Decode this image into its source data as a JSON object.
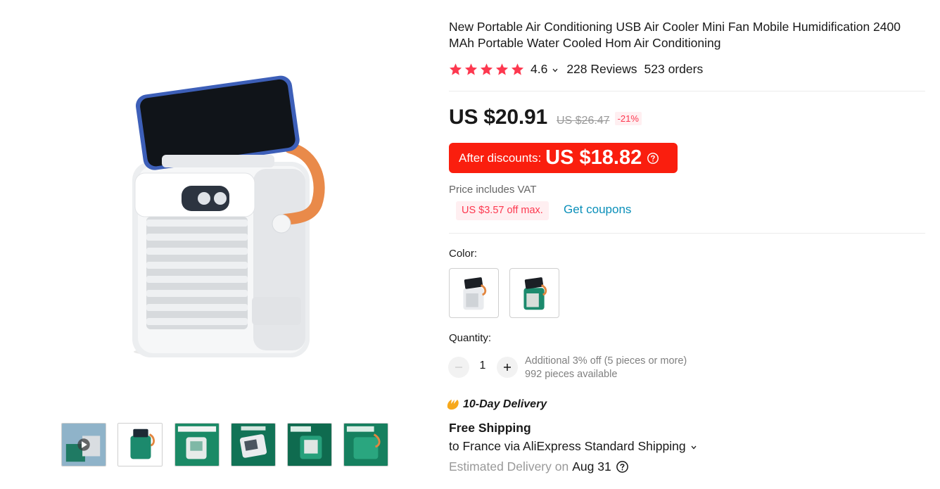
{
  "product": {
    "title": "New Portable Air Conditioning USB Air Cooler Mini Fan Mobile Humidification 2400 MAh Portable Water Cooled Hom Air Conditioning",
    "rating": "4.6",
    "reviews": "228 Reviews",
    "orders": "523 orders",
    "stars": 5
  },
  "gallery": {
    "main_image": "portable-air-cooler-with-phone-stand-image",
    "thumbnails": [
      {
        "name": "video-thumbnail",
        "icon": "play-icon"
      },
      {
        "name": "green-cooler-thumbnail"
      },
      {
        "name": "water-tank-thumbnail"
      },
      {
        "name": "top-view-thumbnail"
      },
      {
        "name": "usb-cooler-thumbnail"
      },
      {
        "name": "humidifier-thumbnail"
      }
    ]
  },
  "price": {
    "current": "US $20.91",
    "original": "US $26.47",
    "discount": "-21%",
    "after_discount_label": "After discounts:",
    "after_discount_price": "US $18.82",
    "vat_note": "Price includes VAT",
    "coupon_tag": "US $3.57 off max.",
    "get_coupons": "Get coupons"
  },
  "color": {
    "label": "Color:",
    "options": [
      "white-variant",
      "green-variant"
    ]
  },
  "quantity": {
    "label": "Quantity:",
    "value": "1",
    "additional_discount": "Additional 3% off (5 pieces or more)",
    "available": "992 pieces available"
  },
  "delivery": {
    "badge": "10-Day Delivery",
    "free_shipping": "Free Shipping",
    "route": "to France via AliExpress Standard Shipping",
    "estimated_label": "Estimated Delivery on",
    "estimated_date": "Aug 31"
  },
  "colors": {
    "star": "#fd384f",
    "price_red": "#fa1e0e",
    "link_blue": "#0a8fb9",
    "badge_orange": "#f7a81b"
  }
}
